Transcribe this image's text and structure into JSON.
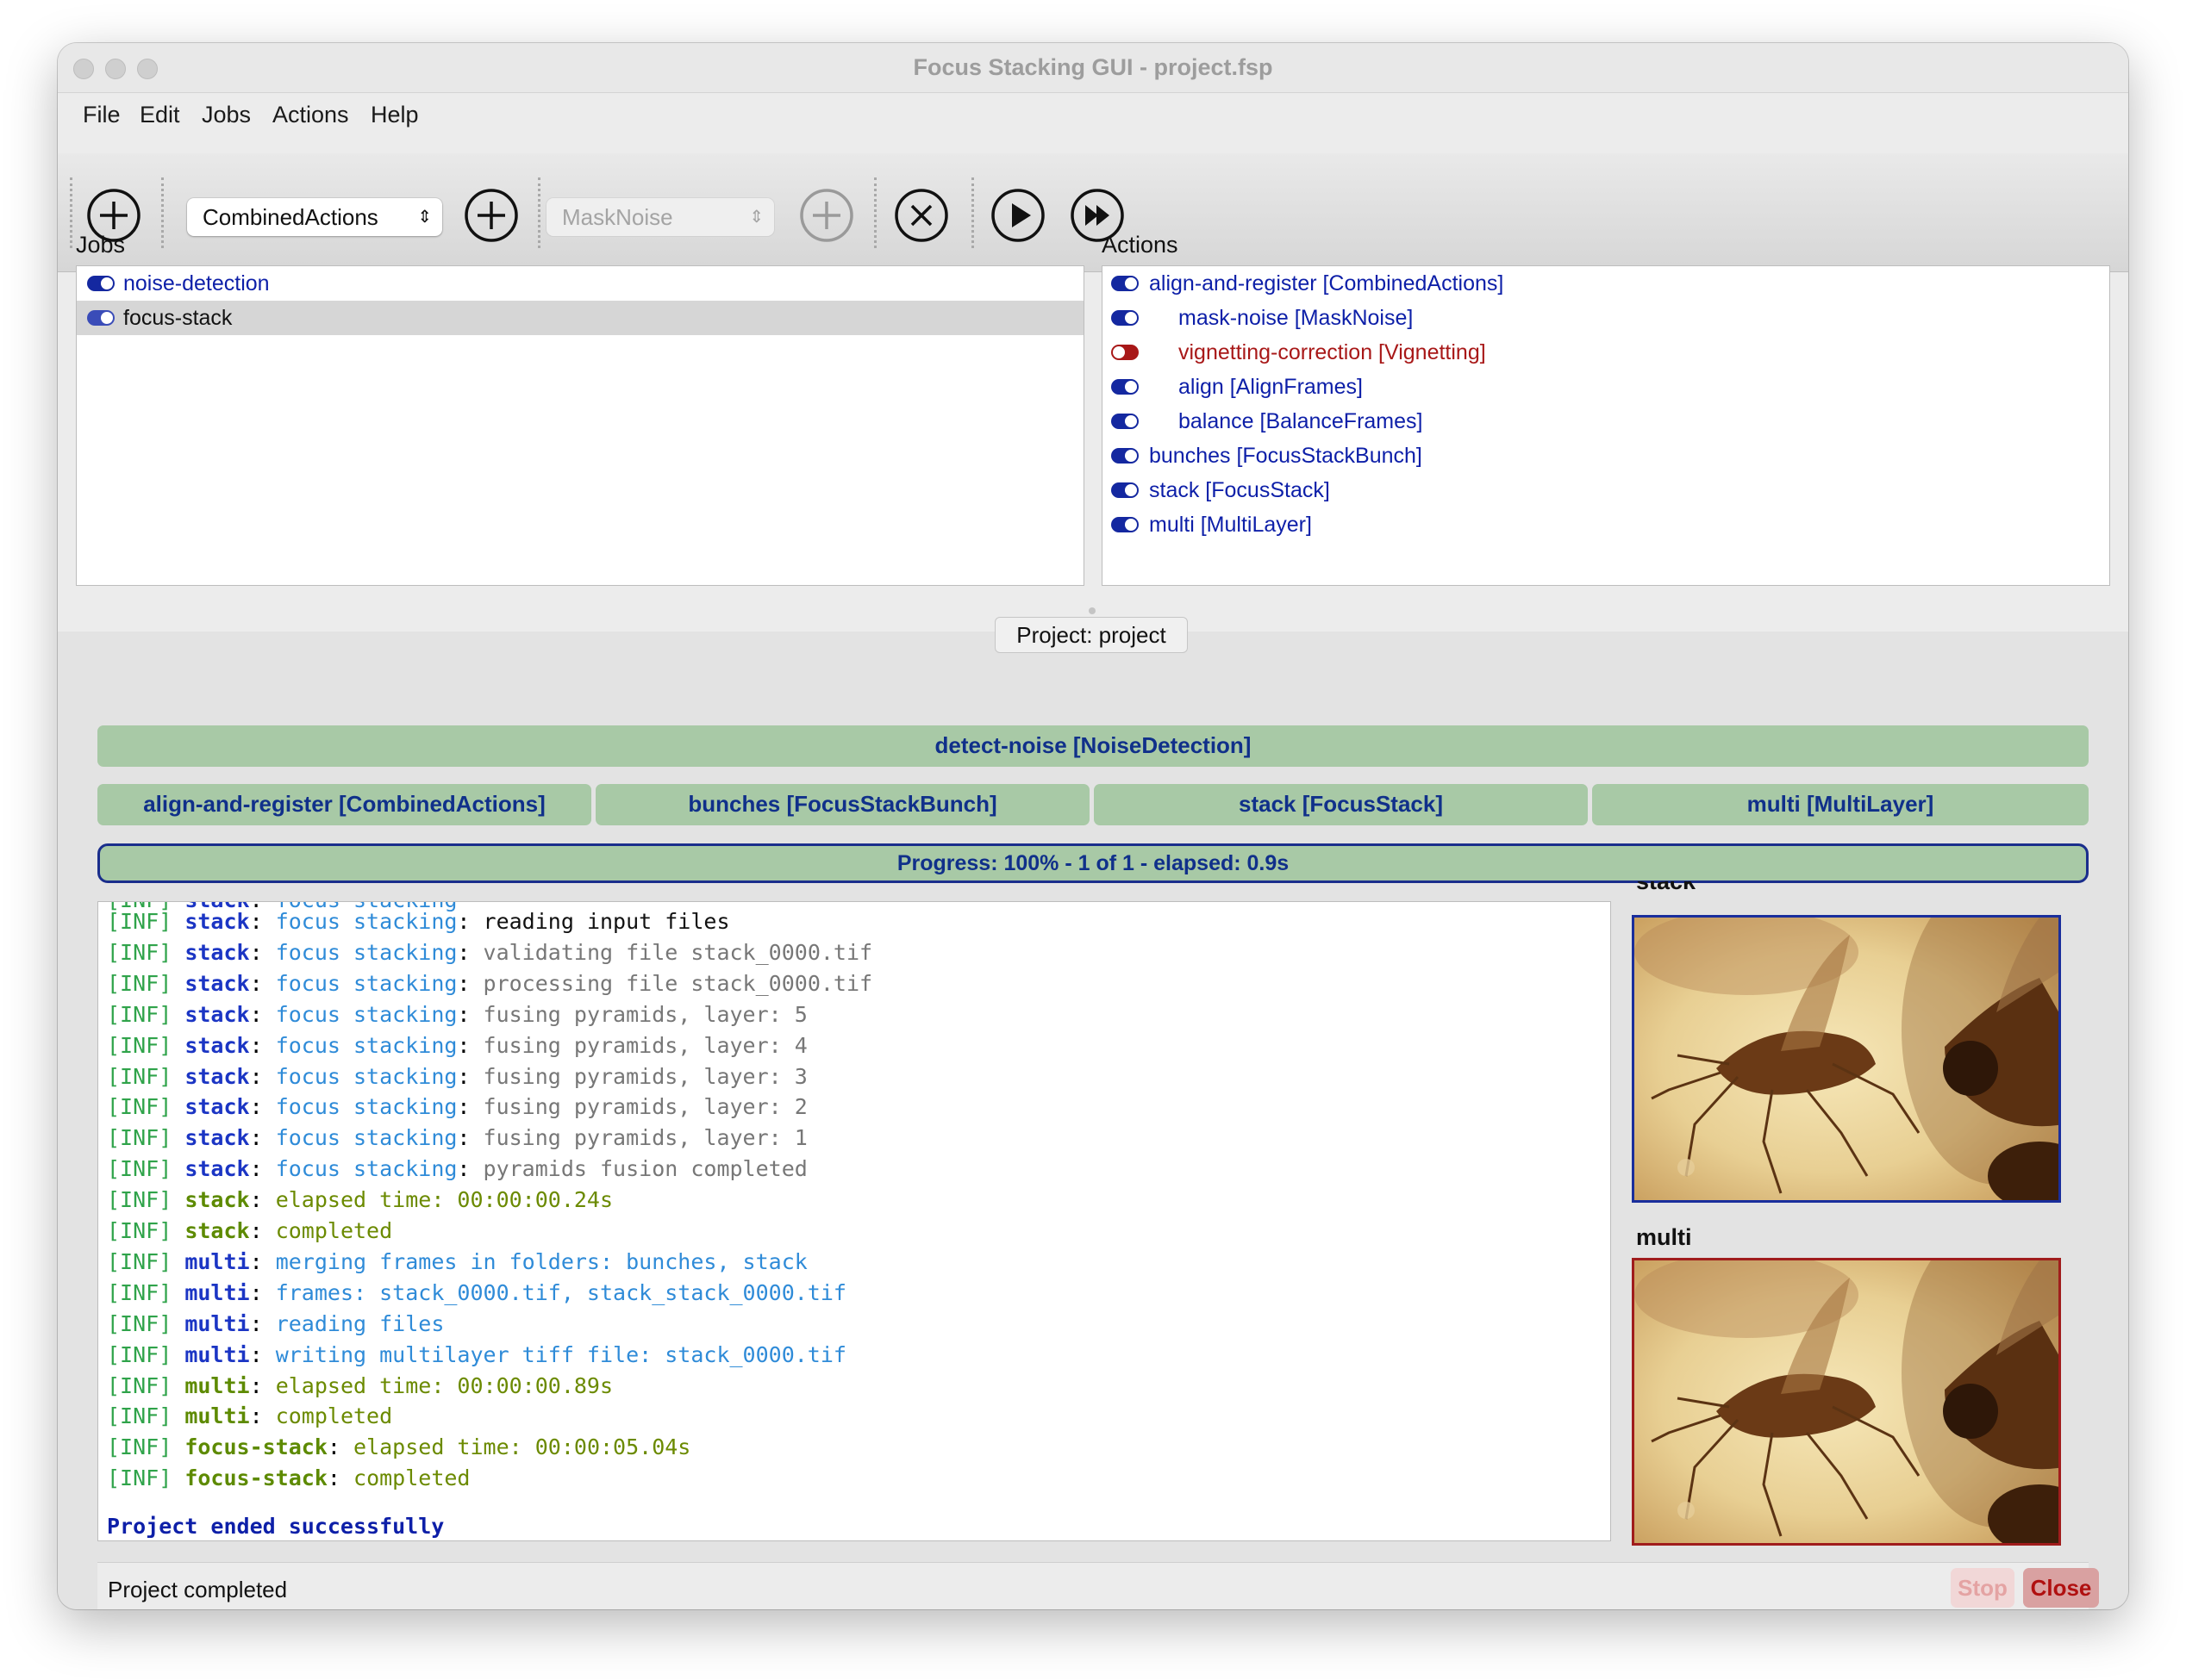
{
  "window": {
    "title": "Focus Stacking GUI - project.fsp"
  },
  "menu": [
    "File",
    "Edit",
    "Jobs",
    "Actions",
    "Help"
  ],
  "toolbar": {
    "add_job_icon": "plus-circle-icon",
    "action_select_value": "CombinedActions",
    "add_action_icon": "plus-circle-icon",
    "subaction_select_value": "MaskNoise",
    "add_subaction_icon": "plus-circle-icon",
    "delete_icon": "x-circle-icon",
    "run_job_icon": "play-circle-icon",
    "run_all_icon": "fast-forward-circle-icon"
  },
  "jobs": {
    "label": "Jobs",
    "items": [
      {
        "label": "noise-detection",
        "enabled": true,
        "selected": false
      },
      {
        "label": "focus-stack",
        "enabled": true,
        "selected": true
      }
    ]
  },
  "actions": {
    "label": "Actions",
    "items": [
      {
        "label": "align-and-register [CombinedActions]",
        "enabled": true,
        "indent": 0
      },
      {
        "label": "mask-noise [MaskNoise]",
        "enabled": true,
        "indent": 1
      },
      {
        "label": "vignetting-correction [Vignetting]",
        "enabled": false,
        "indent": 1
      },
      {
        "label": "align [AlignFrames]",
        "enabled": true,
        "indent": 1
      },
      {
        "label": "balance [BalanceFrames]",
        "enabled": true,
        "indent": 1
      },
      {
        "label": "bunches [FocusStackBunch]",
        "enabled": true,
        "indent": 0
      },
      {
        "label": "stack [FocusStack]",
        "enabled": true,
        "indent": 0
      },
      {
        "label": "multi [MultiLayer]",
        "enabled": true,
        "indent": 0
      }
    ]
  },
  "project": {
    "tab_label": "Project: project",
    "top_bar": "detect-noise [NoiseDetection]",
    "action_bars": [
      "align-and-register [CombinedActions]",
      "bunches [FocusStackBunch]",
      "stack [FocusStack]",
      "multi [MultiLayer]"
    ],
    "progress_text": "Progress: 100% - 1 of 1 - elapsed: 0.9s",
    "progress_value": 1.0
  },
  "log": {
    "partial_top": "[INF] stack: focus stacking",
    "lines": [
      {
        "who": "stack",
        "ctx": "focus stacking",
        "msg": "reading input files",
        "style": "black"
      },
      {
        "who": "stack",
        "ctx": "focus stacking",
        "msg": "validating file stack_0000.tif",
        "style": "grey"
      },
      {
        "who": "stack",
        "ctx": "focus stacking",
        "msg": "processing file stack_0000.tif",
        "style": "grey"
      },
      {
        "who": "stack",
        "ctx": "focus stacking",
        "msg": "fusing pyramids, layer: 5",
        "style": "grey"
      },
      {
        "who": "stack",
        "ctx": "focus stacking",
        "msg": "fusing pyramids, layer: 4",
        "style": "grey"
      },
      {
        "who": "stack",
        "ctx": "focus stacking",
        "msg": "fusing pyramids, layer: 3",
        "style": "grey"
      },
      {
        "who": "stack",
        "ctx": "focus stacking",
        "msg": "fusing pyramids, layer: 2",
        "style": "grey"
      },
      {
        "who": "stack",
        "ctx": "focus stacking",
        "msg": "fusing pyramids, layer: 1",
        "style": "grey"
      },
      {
        "who": "stack",
        "ctx": "focus stacking",
        "msg": "pyramids fusion completed",
        "style": "grey"
      },
      {
        "who": "stack",
        "ctx": "",
        "msg": "elapsed time: 00:00:00.24s",
        "style": "olive",
        "whoStyle": "green"
      },
      {
        "who": "stack",
        "ctx": "",
        "msg": "completed",
        "style": "olive",
        "whoStyle": "green"
      },
      {
        "who": "multi",
        "ctx": "",
        "msg": "merging frames in folders: bunches, stack",
        "style": "blue"
      },
      {
        "who": "multi",
        "ctx": "",
        "msg": "frames: stack_0000.tif, stack_stack_0000.tif",
        "style": "blue"
      },
      {
        "who": "multi",
        "ctx": "",
        "msg": "reading files",
        "style": "blue"
      },
      {
        "who": "multi",
        "ctx": "",
        "msg": "writing multilayer tiff file: stack_0000.tif",
        "style": "blue"
      },
      {
        "who": "multi",
        "ctx": "",
        "msg": "elapsed time: 00:00:00.89s",
        "style": "olive",
        "whoStyle": "green"
      },
      {
        "who": "multi",
        "ctx": "",
        "msg": "completed",
        "style": "olive",
        "whoStyle": "green"
      },
      {
        "who": "focus-stack",
        "ctx": "",
        "msg": "elapsed time: 00:00:05.04s",
        "style": "olive",
        "whoStyle": "green"
      },
      {
        "who": "focus-stack",
        "ctx": "",
        "msg": "completed",
        "style": "olive",
        "whoStyle": "green"
      }
    ],
    "tag": "[INF]",
    "final": "Project ended successfully"
  },
  "thumbnails": [
    {
      "label": "stack",
      "border": "#1a2e9c"
    },
    {
      "label": "multi",
      "border": "#a01c1c"
    }
  ],
  "status": {
    "text": "Project completed",
    "stop_label": "Stop",
    "close_label": "Close"
  },
  "colors": {
    "toggle_on": "#1428a0",
    "toggle_off": "#a81818",
    "bar_green": "#a8c9a6",
    "bar_text": "#10308a"
  }
}
